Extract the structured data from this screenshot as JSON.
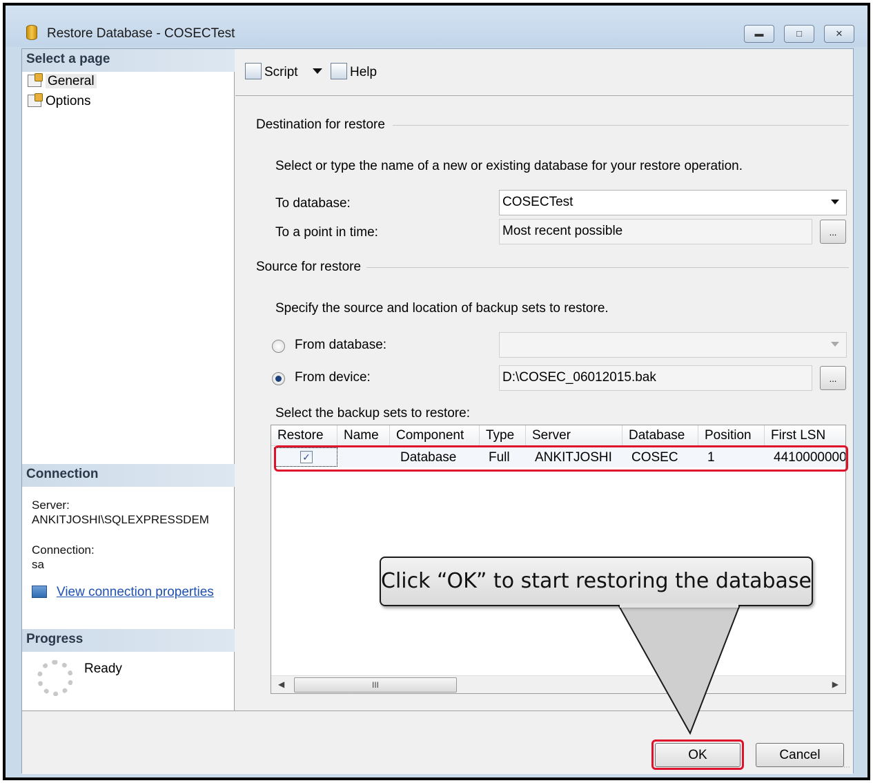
{
  "window": {
    "title": "Restore Database - COSECTest",
    "controls": {
      "minimize_icon": "minimize-icon",
      "maximize_icon": "maximize-icon",
      "close_icon": "close-icon"
    }
  },
  "left_pane": {
    "select_page_header": "Select a page",
    "pages": [
      {
        "label": "General",
        "selected": true
      },
      {
        "label": "Options",
        "selected": false
      }
    ],
    "connection_header": "Connection",
    "server_label": "Server:",
    "server_value": "ANKITJOSHI\\SQLEXPRESSDEM",
    "connection_label": "Connection:",
    "connection_value": "sa",
    "view_connection_link": "View connection properties",
    "progress_header": "Progress",
    "progress_status": "Ready"
  },
  "toolbar": {
    "script_label": "Script",
    "help_label": "Help"
  },
  "destination": {
    "group_label": "Destination for restore",
    "instruction": "Select or type the name of a new or existing database for your restore operation.",
    "to_database_label": "To database:",
    "to_database_value": "COSECTest",
    "point_in_time_label": "To a point in time:",
    "point_in_time_value": "Most recent possible",
    "browse_label": "..."
  },
  "source": {
    "group_label": "Source for restore",
    "instruction": "Specify the source and location of backup sets to restore.",
    "from_database_label": "From database:",
    "from_database_value": "",
    "from_device_label": "From device:",
    "from_device_value": "D:\\COSEC_06012015.bak",
    "selected_option": "From device",
    "browse_label": "...",
    "backup_sets_label": "Select the backup sets to restore:"
  },
  "backup_grid": {
    "columns": [
      "Restore",
      "Name",
      "Component",
      "Type",
      "Server",
      "Database",
      "Position",
      "First LSN"
    ],
    "rows": [
      {
        "restore": true,
        "name": "",
        "component": "Database",
        "type": "Full",
        "server": "ANKITJOSHI",
        "database": "COSEC",
        "position": "1",
        "first_lsn": "4410000000"
      }
    ],
    "scroll_thumb_glyph": "III"
  },
  "buttons": {
    "ok_label": "OK",
    "cancel_label": "Cancel"
  },
  "annotation": {
    "callout_text": "Click “OK” to start restoring the database",
    "highlight_color": "#e0112b"
  }
}
